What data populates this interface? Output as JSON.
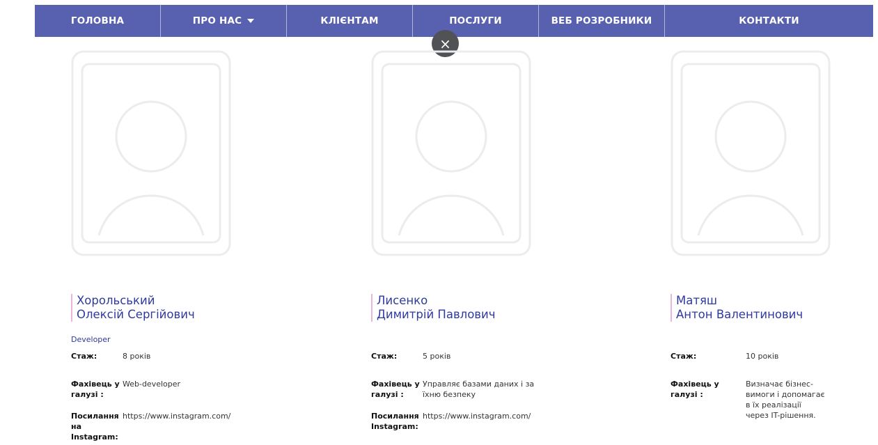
{
  "nav": {
    "items": [
      "ГОЛОВНА",
      "ПРО НАС",
      "КЛІЄНТАМ",
      "ПОСЛУГИ",
      "ВЕБ РОЗРОБНИКИ",
      "КОНТАКТИ"
    ]
  },
  "close_symbol": "×",
  "people": [
    {
      "name_line1": "Хорольський",
      "name_line2": "Олексій Сергійович",
      "role": "Developer",
      "exp_label": "Стаж:",
      "exp_value": "8 років",
      "field_label": "Фахівець у галузі :",
      "field_value": "Web-developer",
      "link_label": "Посилання на Instagram:",
      "link_value": "https://www.instagram.com/"
    },
    {
      "name_line1": "Лисенко",
      "name_line2": "Димитрій Павлович",
      "exp_label": "Стаж:",
      "exp_value": "5 років",
      "field_label": "Фахівець у галузі :",
      "field_value": "Управляє базами даних і за їхню безпеку",
      "link_label": "Посилання Instagram:",
      "link_value": "https://www.instagram.com/"
    },
    {
      "name_line1": "Матяш",
      "name_line2": "Антон Валентинович",
      "exp_label": "Стаж:",
      "exp_value": "10 років",
      "field_label": "Фахівець у галузі :",
      "field_value": "Визначає бізнес-вимоги і допомагає в їх реалізації через IT-рішення."
    }
  ],
  "colors": {
    "nav_bg": "#5860b0",
    "name_color": "#2e3aa0",
    "name_accent_border": "#e9b5df",
    "placeholder_stroke": "#ececec"
  },
  "icons": [
    "close-icon",
    "caret-down-icon",
    "person-placeholder-icon"
  ]
}
